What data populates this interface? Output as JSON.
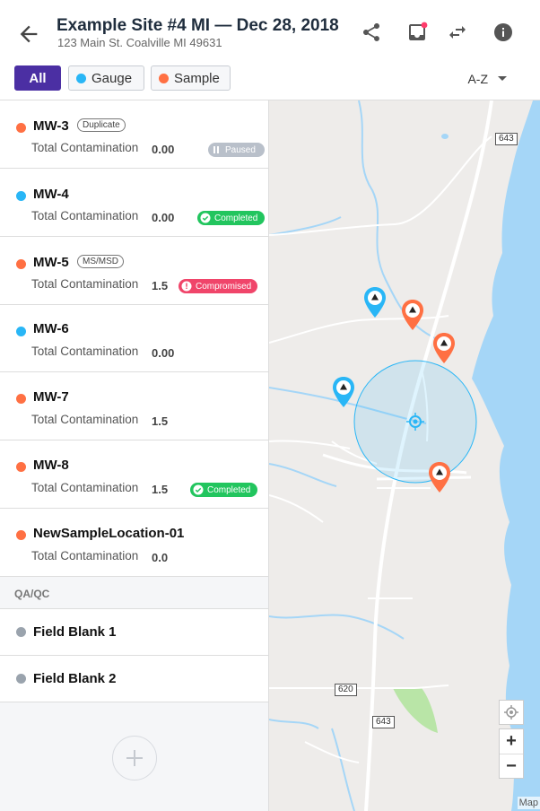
{
  "header": {
    "title": "Example Site #4 MI — Dec 28, 2018",
    "address": "123 Main St. Coalville MI 49631",
    "icons": [
      "back-arrow-icon",
      "share-icon",
      "inbox-icon",
      "swap-icon",
      "info-icon"
    ],
    "notification_color": "#ff3b6b"
  },
  "filters": {
    "all_label": "All",
    "gauge_label": "Gauge",
    "sample_label": "Sample",
    "sort_label": "A-Z",
    "gauge_color": "#29b6f6",
    "sample_color": "#ff7043",
    "accent_color": "#4b2fa3"
  },
  "locations": [
    {
      "name": "MW-3",
      "tag": "Duplicate",
      "metric_label": "Total Contamination",
      "value": "0.00",
      "status": "Paused",
      "type": "sample"
    },
    {
      "name": "MW-4",
      "tag": "",
      "metric_label": "Total Contamination",
      "value": "0.00",
      "status": "Completed",
      "type": "gauge"
    },
    {
      "name": "MW-5",
      "tag": "MS/MSD",
      "metric_label": "Total Contamination",
      "value": "1.5",
      "status": "Compromised",
      "type": "sample"
    },
    {
      "name": "MW-6",
      "tag": "",
      "metric_label": "Total Contamination",
      "value": "0.00",
      "status": "",
      "type": "gauge"
    },
    {
      "name": "MW-7",
      "tag": "",
      "metric_label": "Total Contamination",
      "value": "1.5",
      "status": "",
      "type": "sample"
    },
    {
      "name": "MW-8",
      "tag": "",
      "metric_label": "Total Contamination",
      "value": "1.5",
      "status": "Completed",
      "type": "sample"
    },
    {
      "name": "NewSampleLocation-01",
      "tag": "",
      "metric_label": "Total Contamination",
      "value": "0.0",
      "status": "",
      "type": "sample"
    }
  ],
  "qa": {
    "section_label": "QA/QC",
    "items": [
      {
        "name": "Field Blank 1"
      },
      {
        "name": "Field Blank 2"
      }
    ]
  },
  "status_colors": {
    "Paused": "#b9c0ca",
    "Completed": "#22c55e",
    "Compromised": "#f0456a",
    "qa_dot": "#9aa3ad"
  },
  "map": {
    "road_labels": [
      "643",
      "620",
      "643"
    ],
    "zoom_in": "+",
    "zoom_out": "−",
    "credit": "Map"
  }
}
